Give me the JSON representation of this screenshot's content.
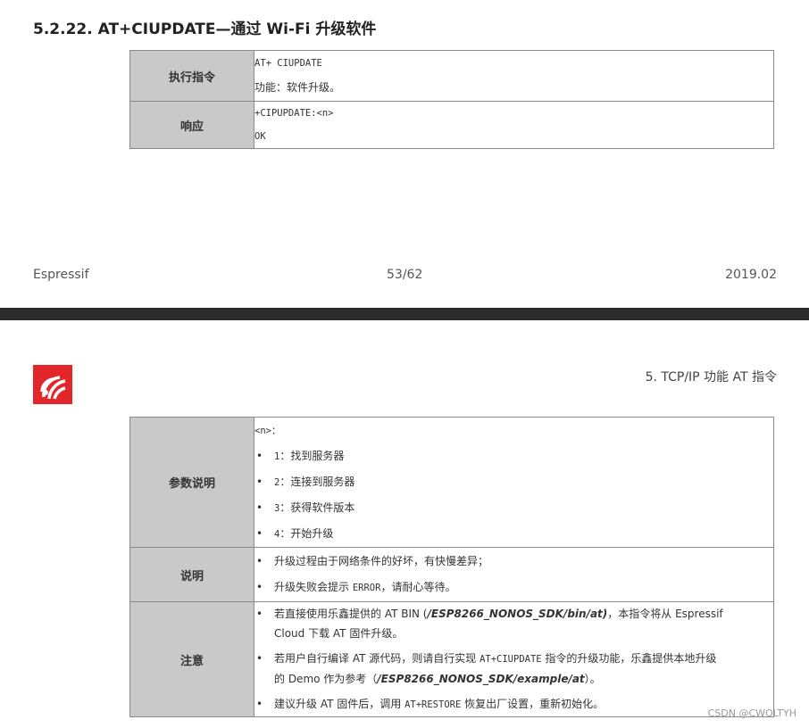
{
  "page1": {
    "section_title": "5.2.22. AT+CIUPDATE—通过 Wi-Fi 升级软件",
    "table": {
      "exec_label": "执行指令",
      "exec_cmd": "AT+ CIUPDATE",
      "exec_desc": "功能：软件升级。",
      "resp_label": "响应",
      "resp_line1": "+CIPUPDATE:<n>",
      "resp_line2": "OK"
    },
    "footer": {
      "left": "Espressif",
      "center": "53/62",
      "right": "2019.02"
    }
  },
  "page2": {
    "header_right": "5. TCP/IP 功能 AT 指令",
    "logo_icon": "espressif-logo-icon",
    "logo_color": "#e3262a",
    "table": {
      "param_label": "参数说明",
      "param_head": "<n>：",
      "params": [
        {
          "num": "1",
          "text": "：找到服务器"
        },
        {
          "num": "2",
          "text": "：连接到服务器"
        },
        {
          "num": "3",
          "text": "：获得软件版本"
        },
        {
          "num": "4",
          "text": "：开始升级"
        }
      ],
      "desc_label": "说明",
      "desc_items": [
        {
          "a": "升级过程由于网络条件的好坏，有快慢差异；"
        },
        {
          "a": "升级失败会提示 ",
          "code": "ERROR",
          "b": "，请耐心等待。"
        }
      ],
      "note_label": "注意",
      "note1_a": "若直接使用乐鑫提供的 AT BIN (",
      "note1_path": "/ESP8266_NONOS_SDK/bin/at)",
      "note1_b": "，本指令将从 Espressif",
      "note1_c": "Cloud 下载 AT 固件升级。",
      "note2_a": "若用户自行编译 AT 源代码，则请自行实现 ",
      "note2_code": "AT+CIUPDATE",
      "note2_b": " 指令的升级功能，乐鑫提供本地升级",
      "note2_c": "的 Demo 作为参考（",
      "note2_path": "/ESP8266_NONOS_SDK/example/at",
      "note2_d": "）。",
      "note3_a": "建议升级 AT 固件后，调用 ",
      "note3_code": "AT+RESTORE",
      "note3_b": " 恢复出厂设置，重新初始化。"
    }
  },
  "watermark": "CSDN @CWQLTYH"
}
